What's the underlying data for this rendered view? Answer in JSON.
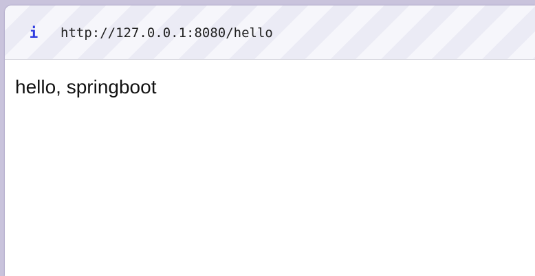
{
  "address_bar": {
    "icon": "info-icon",
    "icon_glyph": "i",
    "icon_color": "#2f3be0",
    "url": "http://127.0.0.1:8080/hello"
  },
  "page": {
    "body_text": "hello, springboot"
  }
}
